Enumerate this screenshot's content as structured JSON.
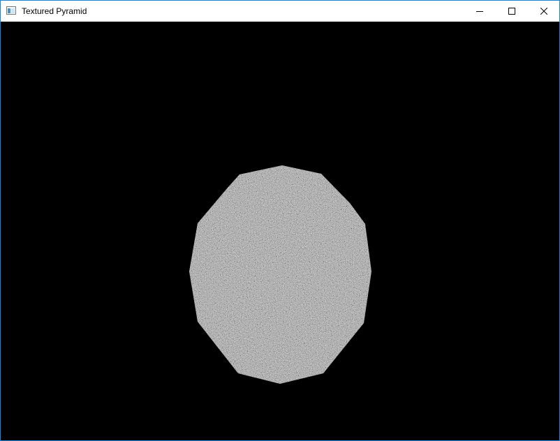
{
  "window": {
    "title": "Textured Pyramid",
    "app_icon": "window-app-icon",
    "controls": {
      "minimize_icon": "minimize-icon",
      "maximize_icon": "maximize-icon",
      "close_icon": "close-icon"
    },
    "border_color": "#1883d7"
  },
  "viewport": {
    "background_color": "#000000",
    "object": {
      "shape": "pyramid-base-polygon",
      "texture": "noise",
      "color": "#6b6b6b"
    }
  }
}
